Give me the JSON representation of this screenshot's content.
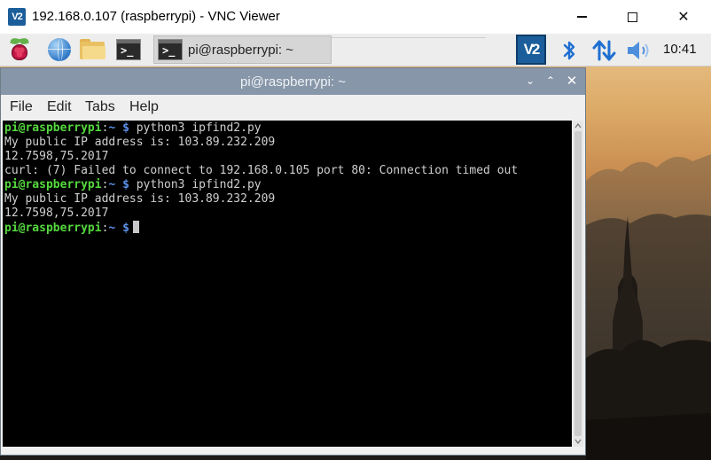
{
  "vnc_window": {
    "title": "192.168.0.107 (raspberrypi) - VNC Viewer",
    "app_icon_text": "V2",
    "controls": {
      "minimize": "minimize",
      "maximize": "maximize",
      "close": "✕"
    }
  },
  "taskbar": {
    "launchers": [
      "raspberry-menu",
      "web-browser",
      "file-manager",
      "terminal"
    ],
    "active_task": {
      "label": "pi@raspberrypi: ~",
      "icon_glyph": ">_"
    },
    "tray": {
      "vnc_icon_text": "V2",
      "icons": [
        "vnc-server",
        "bluetooth",
        "network",
        "volume"
      ],
      "clock": "10:41"
    }
  },
  "terminal": {
    "title": "pi@raspberrypi: ~",
    "title_controls": {
      "minimize": "⌄",
      "maximize": "⌃",
      "close": "✕"
    },
    "menu": [
      "File",
      "Edit",
      "Tabs",
      "Help"
    ],
    "prompt": {
      "user_host": "pi@raspberrypi",
      "sep": ":",
      "path": "~",
      "dollar": "$"
    },
    "lines": [
      {
        "type": "command",
        "text": " python3 ipfind2.py"
      },
      {
        "type": "output",
        "text": "My public IP address is: 103.89.232.209"
      },
      {
        "type": "output",
        "text": "12.7598,75.2017"
      },
      {
        "type": "output",
        "text": "curl: (7) Failed to connect to 192.168.0.105 port 80: Connection timed out"
      },
      {
        "type": "command",
        "text": " python3 ipfind2.py"
      },
      {
        "type": "output",
        "text": "My public IP address is: 103.89.232.209"
      },
      {
        "type": "output",
        "text": "12.7598,75.2017"
      },
      {
        "type": "command",
        "text": ""
      }
    ]
  },
  "colors": {
    "prompt_user": "#55d93e",
    "prompt_path": "#5b8fe8",
    "terminal_bg": "#000000",
    "terminal_text": "#cfcfcf",
    "titlebar_active": "#8796a8"
  }
}
